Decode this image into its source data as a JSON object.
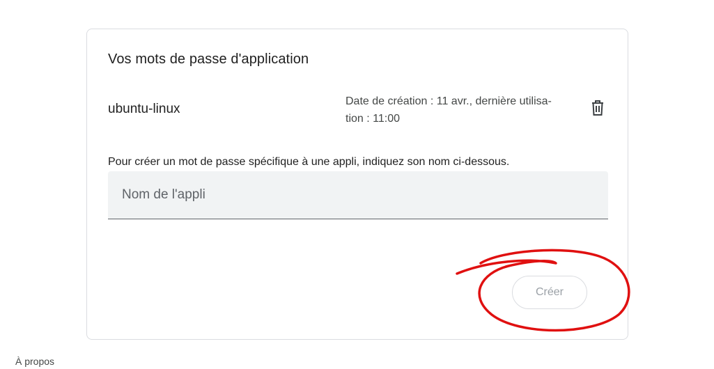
{
  "card": {
    "title": "Vos mots de passe d'application",
    "passwords": [
      {
        "name": "ubuntu-linux",
        "meta_line1": "Date de création  : 11 avr., dernière utilisa-",
        "meta_line2": "tion : 11:00",
        "delete_icon": "trash-icon"
      }
    ],
    "instructions": "Pour créer un mot de passe spécifique à une appli, indiquez son nom ci-dessous.",
    "app_name_input": {
      "value": "",
      "placeholder": "Nom de l'appli"
    },
    "create_button": "Créer"
  },
  "footer": {
    "about_link": "À propos"
  },
  "colors": {
    "annotation": "#e01010",
    "border": "#dadce0",
    "input_bg": "#f1f3f4",
    "disabled_text": "#9aa0a6"
  }
}
